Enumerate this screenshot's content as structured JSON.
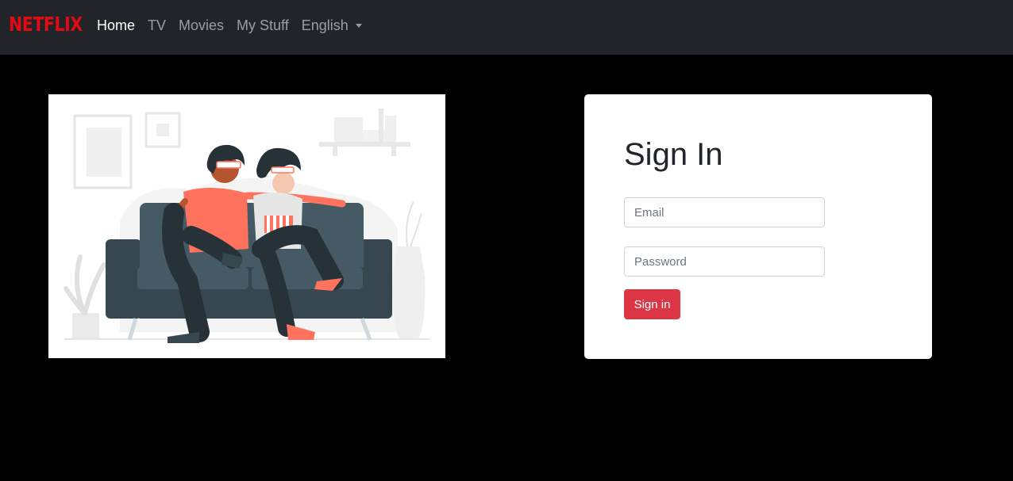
{
  "navbar": {
    "brand": "NETFLIX",
    "links": [
      {
        "label": "Home",
        "active": true
      },
      {
        "label": "TV",
        "active": false
      },
      {
        "label": "Movies",
        "active": false
      },
      {
        "label": "My Stuff",
        "active": false
      }
    ],
    "language_dropdown": "English"
  },
  "hero": {
    "illustration": "couple-watching-movie-on-sofa-illustration"
  },
  "signin": {
    "title": "Sign In",
    "email_placeholder": "Email",
    "email_value": "",
    "password_placeholder": "Password",
    "password_value": "",
    "button_label": "Sign in"
  },
  "colors": {
    "brand_red": "#e50914",
    "navbar_bg": "#212529",
    "page_bg": "#000000",
    "button_red": "#dc3545"
  }
}
